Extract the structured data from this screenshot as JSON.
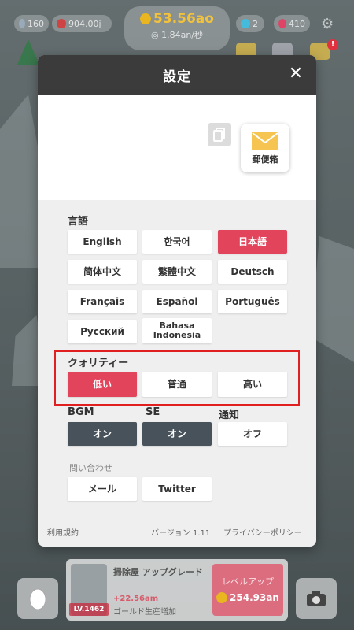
{
  "hud": {
    "gems": "160",
    "rubies": "904.00j",
    "main_currency": "53.56ao",
    "rate": "1.84an/秒",
    "drops": "2",
    "hearts": "410"
  },
  "modal": {
    "title": "設定",
    "close_symbol": "✕",
    "mailbox_label": "郵便箱",
    "language_label": "言語",
    "languages": [
      {
        "label": "English",
        "selected": false
      },
      {
        "label": "한국어",
        "selected": false
      },
      {
        "label": "日本語",
        "selected": true
      },
      {
        "label": "简体中文",
        "selected": false
      },
      {
        "label": "繁體中文",
        "selected": false
      },
      {
        "label": "Deutsch",
        "selected": false
      },
      {
        "label": "Français",
        "selected": false
      },
      {
        "label": "Español",
        "selected": false
      },
      {
        "label": "Português",
        "selected": false
      },
      {
        "label": "Русский",
        "selected": false
      },
      {
        "label": "Bahasa Indonesia",
        "selected": false
      }
    ],
    "quality_label": "クォリティー",
    "quality_options": [
      {
        "label": "低い",
        "selected": true
      },
      {
        "label": "普通",
        "selected": false
      },
      {
        "label": "高い",
        "selected": false
      }
    ],
    "bgm_label": "BGM",
    "bgm_value": "オン",
    "se_label": "SE",
    "se_value": "オン",
    "notify_label": "通知",
    "notify_value": "オフ",
    "contact_label": "問い合わせ",
    "contact_mail": "メール",
    "contact_twitter": "Twitter",
    "footer_terms": "利用規約",
    "footer_version": "バージョン 1.11",
    "footer_privacy": "プライバシーポリシー"
  },
  "bottom": {
    "upgrade_title": "掃除屋 アップグレード",
    "level": "LV.1462",
    "gain": "+22.56am",
    "description": "ゴールド生産増加",
    "levelup_label": "レベルアップ",
    "levelup_cost": "254.93an"
  },
  "colors": {
    "accent": "#e2445c",
    "dark_toggle": "#47525b",
    "header": "#3b3b3b",
    "highlight": "#e02020"
  }
}
